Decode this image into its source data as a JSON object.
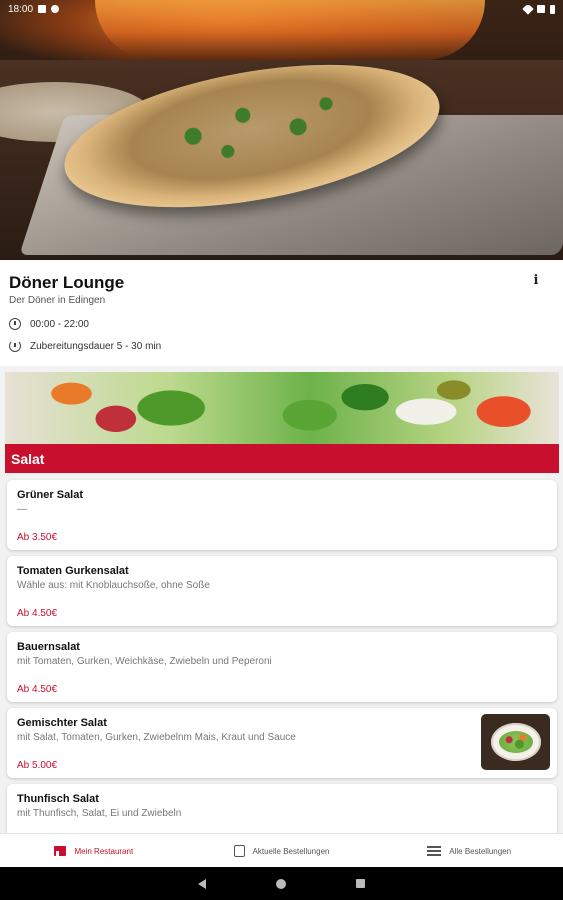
{
  "status_bar": {
    "time": "18:00"
  },
  "restaurant": {
    "name": "Döner Lounge",
    "tagline": "Der Döner in Edingen",
    "hours": "00:00 - 22:00",
    "prep_time": "Zubereitungsdauer 5 - 30 min"
  },
  "category": {
    "name": "Salat"
  },
  "items": [
    {
      "name": "Grüner Salat",
      "desc": "—",
      "price": "Ab 3.50€"
    },
    {
      "name": "Tomaten Gurkensalat",
      "desc": "Wähle aus: mit Knoblauchsoße, ohne Soße",
      "price": "Ab 4.50€"
    },
    {
      "name": "Bauernsalat",
      "desc": "mit Tomaten, Gurken, Weichkäse, Zwiebeln und Peperoni",
      "price": "Ab 4.50€"
    },
    {
      "name": "Gemischter Salat",
      "desc": "mit Salat, Tomaten, Gurken, Zwiebelnm Mais, Kraut und Sauce",
      "price": "Ab 5.00€"
    },
    {
      "name": "Thunfisch Salat",
      "desc": "mit Thunfisch, Salat, Ei und Zwiebeln",
      "price": ""
    }
  ],
  "bottom_nav": [
    {
      "label": "Mein Restaurant",
      "icon": "store-icon",
      "active": true
    },
    {
      "label": "Aktuelle Bestellungen",
      "icon": "shopping-bag-icon",
      "active": false
    },
    {
      "label": "Alle Bestellungen",
      "icon": "list-icon",
      "active": false
    }
  ],
  "colors": {
    "accent": "#c8102e"
  }
}
